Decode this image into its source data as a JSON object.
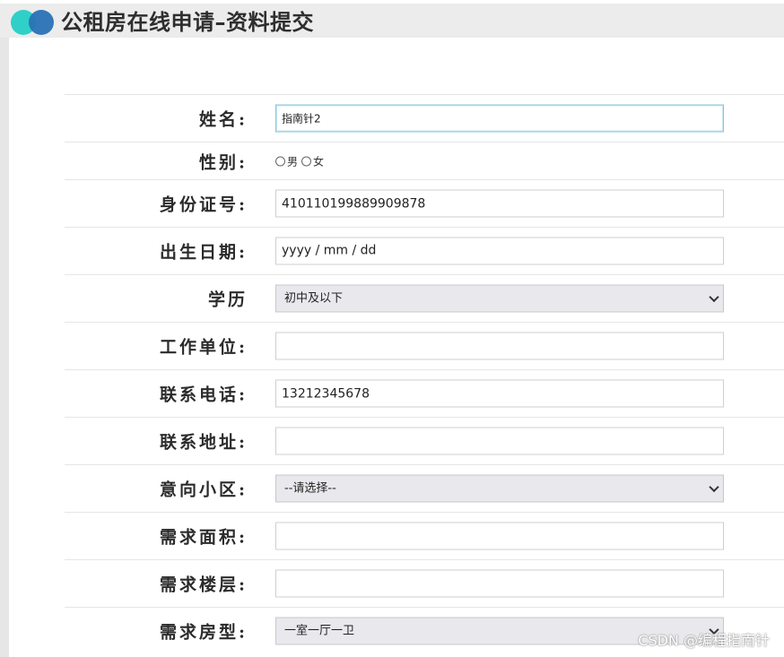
{
  "header": {
    "title": "公租房在线申请–资料提交"
  },
  "form": {
    "name": {
      "label": "姓名:",
      "value": "指南针2"
    },
    "gender": {
      "label": "性别:",
      "options": [
        "男",
        "女"
      ]
    },
    "id_number": {
      "label": "身份证号:",
      "value": "410110199889909878"
    },
    "birth_date": {
      "label": "出生日期:",
      "placeholder": "yyyy / mm / dd"
    },
    "education": {
      "label": "学历",
      "selected": "初中及以下"
    },
    "employer": {
      "label": "工作单位:",
      "value": ""
    },
    "phone": {
      "label": "联系电话:",
      "value": "13212345678"
    },
    "address": {
      "label": "联系地址:",
      "value": ""
    },
    "community": {
      "label": "意向小区:",
      "selected": "--请选择--"
    },
    "area": {
      "label": "需求面积:",
      "value": ""
    },
    "floor": {
      "label": "需求楼层:",
      "value": ""
    },
    "room_type": {
      "label": "需求房型:",
      "selected": "一室一厅一卫"
    }
  },
  "watermark": "CSDN @编程指南针",
  "colors": {
    "logo_teal": "#2fd0c8",
    "logo_blue": "#2a72b6",
    "topbar": "#ececec"
  }
}
